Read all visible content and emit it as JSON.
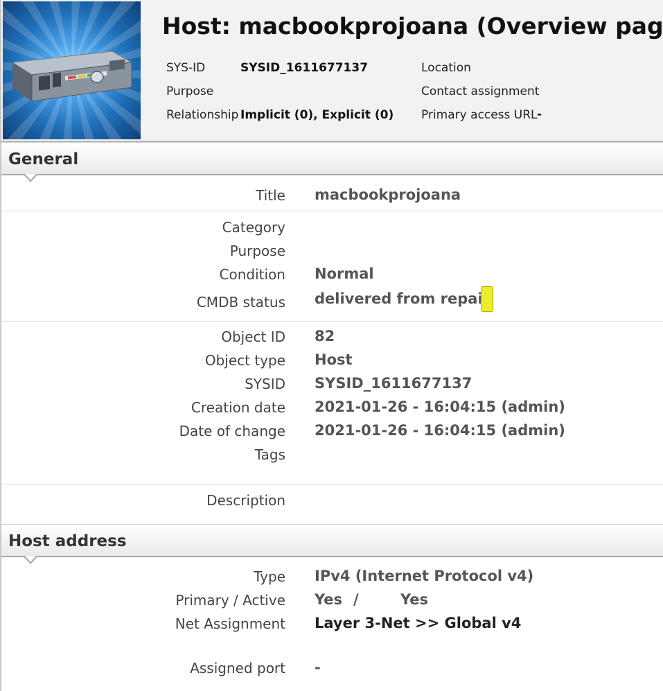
{
  "header": {
    "title": "Host: macbookprojoana (Overview page)",
    "sysid_label": "SYS-ID",
    "sysid_value": "SYSID_1611677137",
    "purpose_label": "Purpose",
    "relationship_label": "Relationship",
    "relationship_value": "Implicit (0), Explicit (0)",
    "location_label": "Location",
    "contact_label": "Contact assignment",
    "access_url_label": "Primary access URL",
    "access_url_value": "-"
  },
  "general": {
    "section_title": "General",
    "title_label": "Title",
    "title_value": "macbookprojoana",
    "category_label": "Category",
    "purpose_label": "Purpose",
    "condition_label": "Condition",
    "condition_value": "Normal",
    "cmdb_label": "CMDB status",
    "cmdb_value": "delivered from repair",
    "cmdb_color": "#ecec2d",
    "object_id_label": "Object ID",
    "object_id_value": "82",
    "object_type_label": "Object type",
    "object_type_value": "Host",
    "sysid_label": "SYSID",
    "sysid_value": "SYSID_1611677137",
    "creation_label": "Creation date",
    "creation_value": "2021-01-26 - 16:04:15 (admin)",
    "change_label": "Date of change",
    "change_value": "2021-01-26 - 16:04:15 (admin)",
    "tags_label": "Tags",
    "description_label": "Description"
  },
  "host_address": {
    "section_title": "Host address",
    "type_label": "Type",
    "type_value": "IPv4 (Internet Protocol v4)",
    "primary_label": "Primary / Active",
    "primary_value": "Yes",
    "separator": "/",
    "active_value": "Yes",
    "net_label": "Net Assignment",
    "net_value": "Layer 3-Net >> Global v4",
    "port_label": "Assigned port",
    "port_value": "-"
  }
}
